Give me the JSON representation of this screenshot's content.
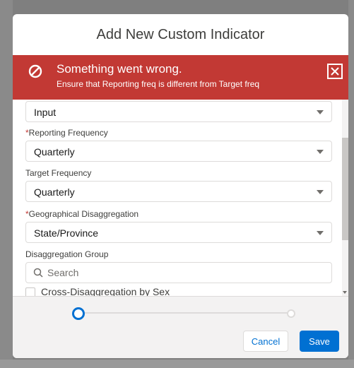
{
  "modal": {
    "title": "Add New Custom Indicator"
  },
  "error": {
    "title": "Something went wrong.",
    "message": "Ensure that Reporting freq is different from Target freq",
    "color": "#c23934",
    "icon": "ban-icon",
    "close_icon": "close-icon"
  },
  "fields": {
    "indicator_type": {
      "value": "Input"
    },
    "reporting_frequency": {
      "required_mark": "*",
      "label": "Reporting Frequency",
      "value": "Quarterly"
    },
    "target_frequency": {
      "label": "Target Frequency",
      "value": "Quarterly"
    },
    "geo_disaggregation": {
      "required_mark": "*",
      "label": "Geographical Disaggregation",
      "value": "State/Province"
    },
    "disaggregation_group": {
      "label": "Disaggregation Group",
      "search_placeholder": "Search"
    },
    "cross_disaggregation": {
      "label": "Cross-Disaggregation by Sex",
      "checked": false
    }
  },
  "footer": {
    "progress": {
      "current_step": 1,
      "total_steps": 2
    },
    "cancel_label": "Cancel",
    "save_label": "Save"
  },
  "colors": {
    "brand": "#0070d2",
    "error": "#c23934"
  }
}
